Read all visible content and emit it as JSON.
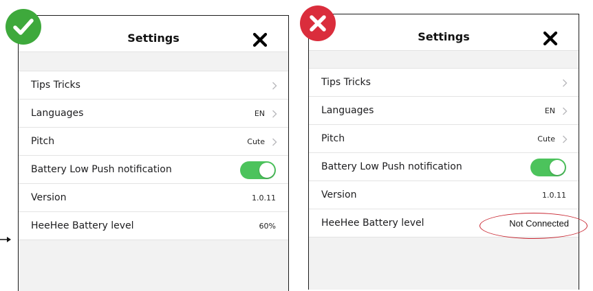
{
  "colors": {
    "toggle_on": "#4cc35c",
    "good_badge": "#3ea93c",
    "bad_badge": "#da2d3c",
    "highlight_oval": "#c8242f"
  },
  "icons": {
    "badge_left": "checkmark-icon",
    "badge_right": "cross-icon",
    "close": "close-icon",
    "row_chevron": "chevron-right-icon",
    "pointer": "arrow-right-icon"
  },
  "left_screen": {
    "header": {
      "title": "Settings"
    },
    "rows": {
      "tips": {
        "label": "Tips Tricks"
      },
      "languages": {
        "label": "Languages",
        "value": "EN"
      },
      "pitch": {
        "label": "Pitch",
        "value": "Cute"
      },
      "battery_push": {
        "label": "Battery Low Push notification",
        "toggle_on": true
      },
      "version": {
        "label": "Version",
        "value": "1.0.11"
      },
      "battery_level": {
        "label": "HeeHee Battery level",
        "value": "60%"
      }
    }
  },
  "right_screen": {
    "header": {
      "title": "Settings"
    },
    "rows": {
      "tips": {
        "label": "Tips Tricks"
      },
      "languages": {
        "label": "Languages",
        "value": "EN"
      },
      "pitch": {
        "label": "Pitch",
        "value": "Cute"
      },
      "battery_push": {
        "label": "Battery Low Push notification",
        "toggle_on": true
      },
      "version": {
        "label": "Version",
        "value": "1.0.11"
      },
      "battery_level": {
        "label": "HeeHee Battery level",
        "value": "Not Connected"
      }
    }
  }
}
